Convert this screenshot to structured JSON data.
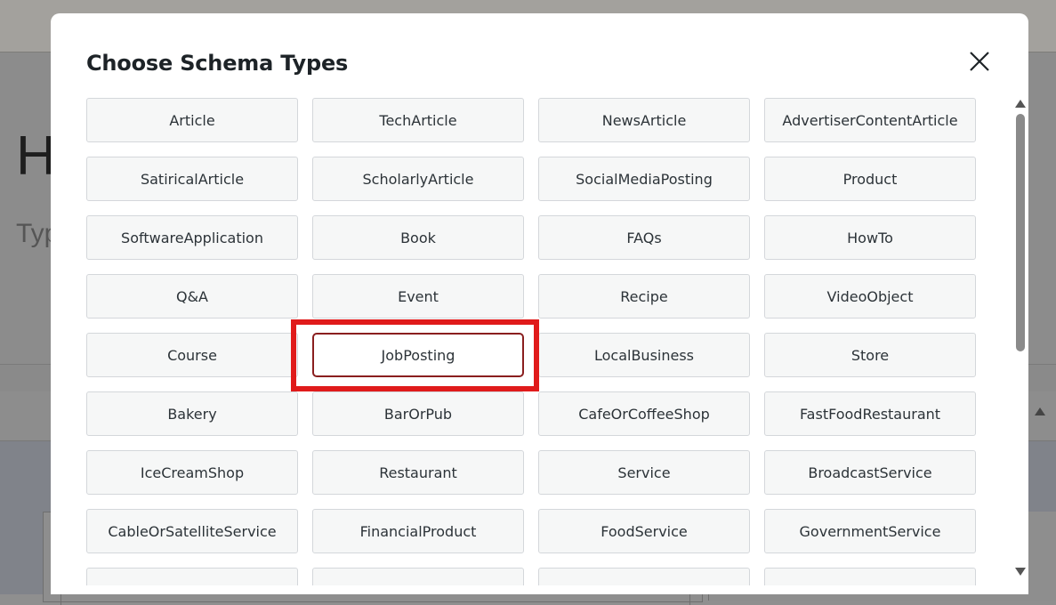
{
  "modal": {
    "title": "Choose Schema Types",
    "close_icon": "close-icon"
  },
  "schema_types": [
    "Article",
    "TechArticle",
    "NewsArticle",
    "AdvertiserContentArticle",
    "SatiricalArticle",
    "ScholarlyArticle",
    "SocialMediaPosting",
    "Product",
    "SoftwareApplication",
    "Book",
    "FAQs",
    "HowTo",
    "Q&A",
    "Event",
    "Recipe",
    "VideoObject",
    "Course",
    "JobPosting",
    "LocalBusiness",
    "Store",
    "Bakery",
    "BarOrPub",
    "CafeOrCoffeeShop",
    "FastFoodRestaurant",
    "IceCreamShop",
    "Restaurant",
    "Service",
    "BroadcastService",
    "CableOrSatelliteService",
    "FinancialProduct",
    "FoodService",
    "GovernmentService",
    "",
    "",
    "",
    ""
  ],
  "selected_type": "JobPosting",
  "background": {
    "heading_fragment": "H",
    "subtext_fragment": "Typ"
  },
  "colors": {
    "highlight": "#e01b1b",
    "selected_border": "#8a1f1f"
  }
}
